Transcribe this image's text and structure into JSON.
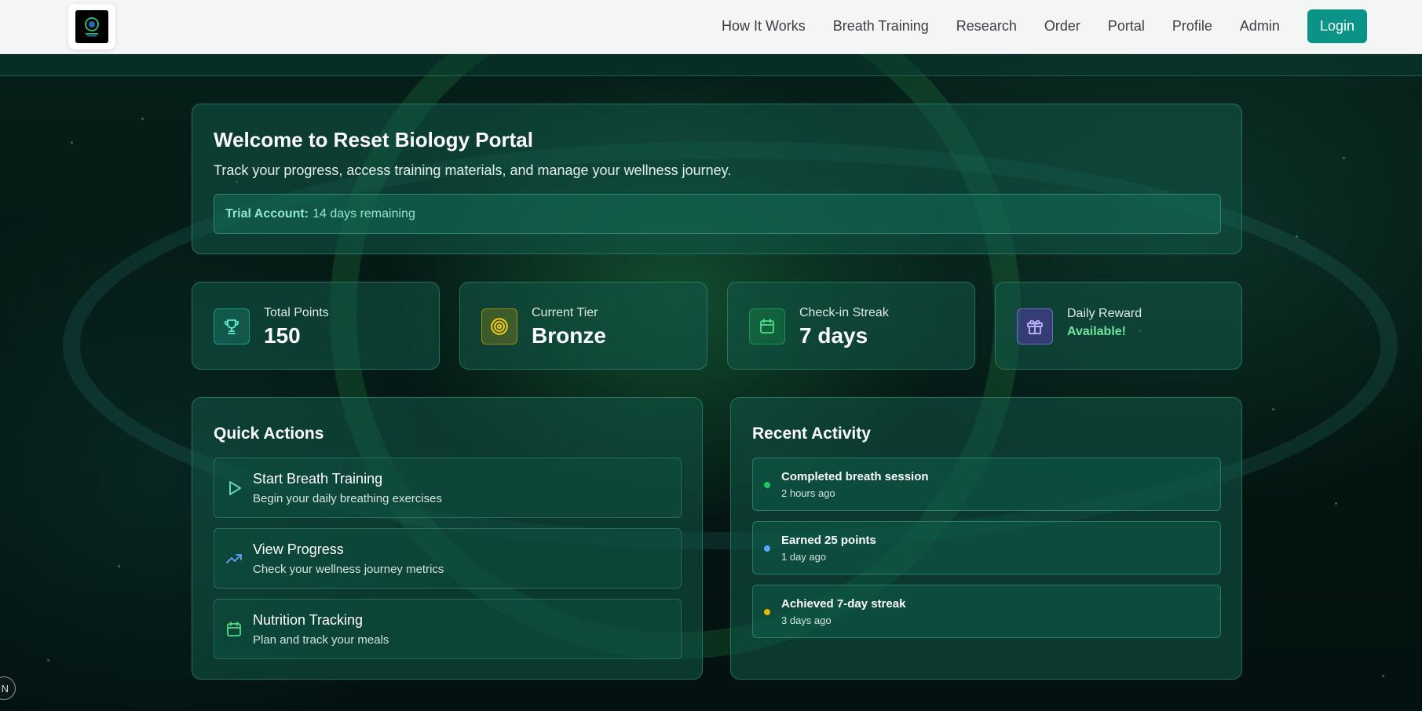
{
  "nav": {
    "logo_icon": "reset-biology-logo",
    "links": [
      "How It Works",
      "Breath Training",
      "Research",
      "Order",
      "Portal",
      "Profile",
      "Admin"
    ],
    "login_label": "Login"
  },
  "welcome": {
    "title": "Welcome to Reset Biology Portal",
    "subtitle": "Track your progress, access training materials, and manage your wellness journey.",
    "trial_label": "Trial Account:",
    "trial_text": "14 days remaining"
  },
  "stats": [
    {
      "icon": "trophy-icon",
      "label": "Total Points",
      "value": "150",
      "color": "#2dd4bf"
    },
    {
      "icon": "target-icon",
      "label": "Current Tier",
      "value": "Bronze",
      "color": "#eab308"
    },
    {
      "icon": "calendar-icon",
      "label": "Check-in Streak",
      "value": "7 days",
      "color": "#22c55e"
    },
    {
      "icon": "gift-icon",
      "label": "Daily Reward",
      "value": "Available!",
      "color": "#a78bfa"
    }
  ],
  "quick_actions": {
    "title": "Quick Actions",
    "items": [
      {
        "icon": "play-icon",
        "title": "Start Breath Training",
        "subtitle": "Begin your daily breathing exercises"
      },
      {
        "icon": "trending-up-icon",
        "title": "View Progress",
        "subtitle": "Check your wellness journey metrics"
      },
      {
        "icon": "calendar-icon",
        "title": "Nutrition Tracking",
        "subtitle": "Plan and track your meals"
      }
    ]
  },
  "recent_activity": {
    "title": "Recent Activity",
    "items": [
      {
        "title": "Completed breath session",
        "time": "2 hours ago",
        "color": "#22c55e"
      },
      {
        "title": "Earned 25 points",
        "time": "1 day ago",
        "color": "#60a5fa"
      },
      {
        "title": "Achieved 7-day streak",
        "time": "3 days ago",
        "color": "#eab308"
      }
    ]
  },
  "corner": {
    "label": "N"
  }
}
